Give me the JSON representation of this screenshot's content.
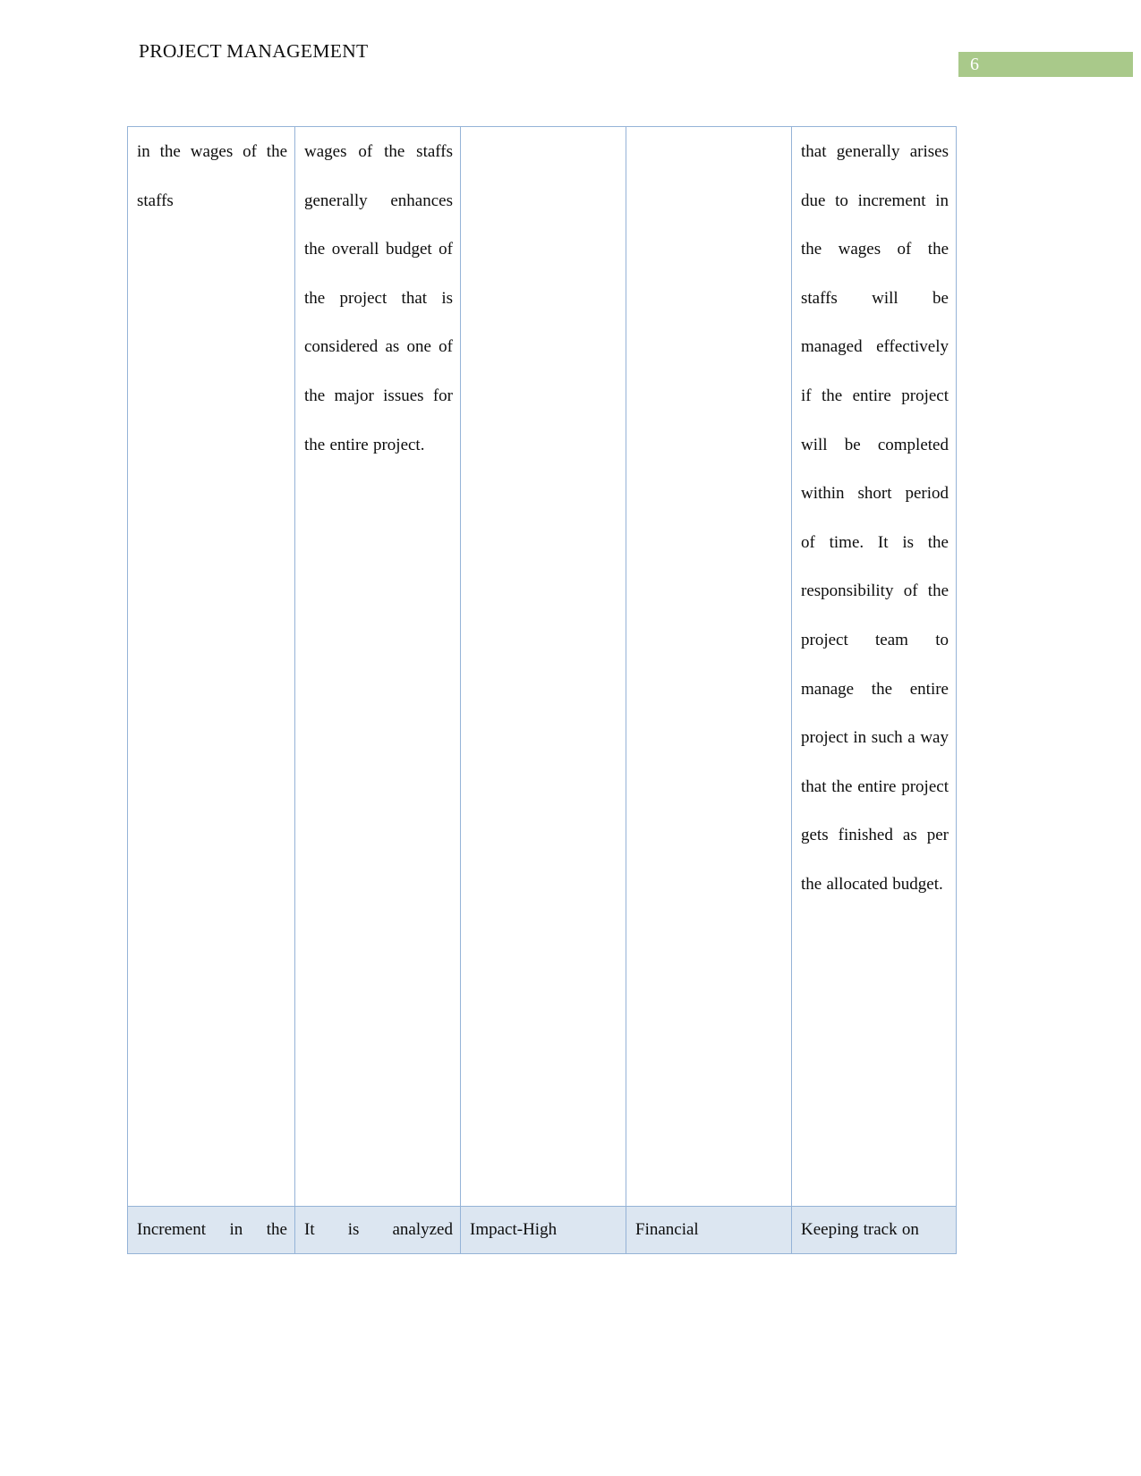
{
  "header": {
    "title": "PROJECT MANAGEMENT",
    "page_number": "6",
    "badge_color": "#a9c98a"
  },
  "table": {
    "border_color": "#95b3d7",
    "shaded_row_color": "#dce6f1",
    "columns": 5,
    "rows": [
      {
        "name": "continuation-row",
        "shaded": false,
        "cells": [
          "in the wages of the staffs",
          "wages of the staffs generally enhances the overall budget of the project that is considered as one of the major issues for the entire project.",
          "",
          "",
          "that generally arises due to increment in the wages of the staffs will be managed effectively if the entire project will be completed within short period of time. It is the responsibility of the project team to manage the entire project in such a way that the entire project gets finished as per the allocated budget."
        ]
      },
      {
        "name": "risk-summary-row",
        "shaded": true,
        "cells": [
          "Increment in the",
          "It is analyzed",
          "Impact-High",
          "Financial",
          "Keeping track on"
        ]
      }
    ]
  }
}
